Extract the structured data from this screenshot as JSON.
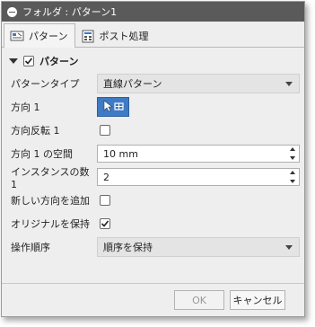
{
  "window": {
    "title": "フォルダ : パターン1"
  },
  "tabs": [
    {
      "label": "パターン",
      "icon": "pattern-tab-icon",
      "active": true
    },
    {
      "label": "ポスト処理",
      "icon": "post-process-tab-icon",
      "active": false
    }
  ],
  "section": {
    "title": "パターン",
    "enabled": true
  },
  "fields": {
    "pattern_type": {
      "label": "パターンタイプ",
      "value": "直線パターン"
    },
    "direction1": {
      "label": "方向 1",
      "icon": "select-geometry-icon"
    },
    "reverse1": {
      "label": "方向反転 1",
      "checked": false
    },
    "spacing1": {
      "label": "方向 1 の空間",
      "value": "10 mm"
    },
    "instances1": {
      "label": "インスタンスの数 1",
      "value": "2"
    },
    "add_direction": {
      "label": "新しい方向を追加",
      "checked": false
    },
    "keep_original": {
      "label": "オリジナルを保持",
      "checked": true
    },
    "operation_order": {
      "label": "操作順序",
      "value": "順序を保持"
    }
  },
  "buttons": {
    "ok": "OK",
    "cancel": "キャンセル"
  },
  "colors": {
    "titlebar": "#5a5a5a",
    "select_button": "#3e7bc4"
  }
}
